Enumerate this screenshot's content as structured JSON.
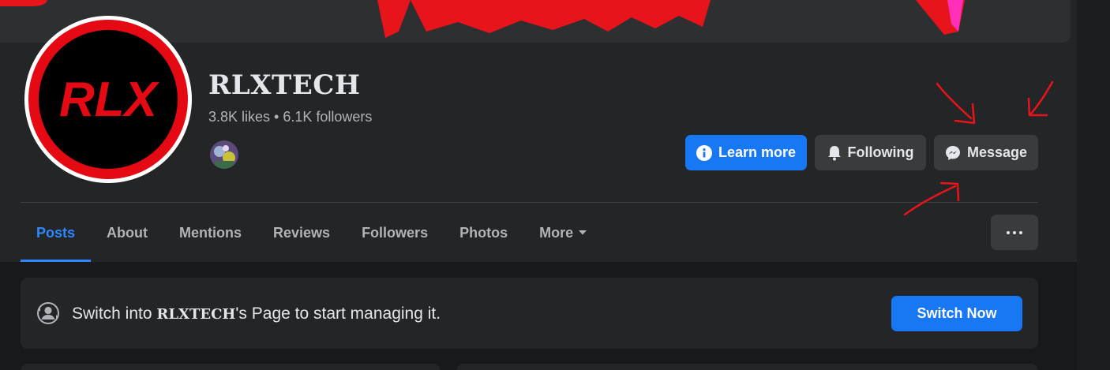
{
  "page": {
    "name": "RLXTECH",
    "stats": "3.8K likes • 6.1K followers",
    "avatar_text": "RLX"
  },
  "actions": {
    "learn_more": "Learn more",
    "following": "Following",
    "message": "Message"
  },
  "tabs": [
    {
      "label": "Posts",
      "active": true
    },
    {
      "label": "About"
    },
    {
      "label": "Mentions"
    },
    {
      "label": "Reviews"
    },
    {
      "label": "Followers"
    },
    {
      "label": "Photos"
    },
    {
      "label": "More"
    }
  ],
  "switch_banner": {
    "prefix": "Switch into ",
    "page_name": "RLXTECH",
    "suffix": "'s Page to start managing it.",
    "button": "Switch Now"
  },
  "colors": {
    "accent": "#1877f2",
    "active_tab": "#2d88ff",
    "logo_red": "#e50914",
    "annotation_red": "#e8141b"
  },
  "icons": [
    "info-icon",
    "bell-icon",
    "messenger-icon",
    "chevron-down-icon",
    "more-dots-icon",
    "profile-switch-icon"
  ]
}
